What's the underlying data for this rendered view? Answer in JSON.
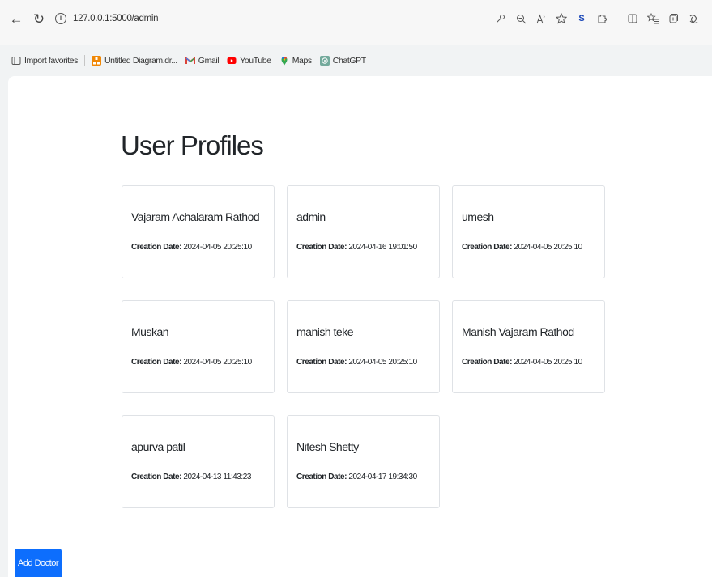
{
  "browser": {
    "url": "127.0.0.1:5000/admin",
    "back_glyph": "←",
    "reload_glyph": "↻",
    "info_glyph": "i",
    "toolbar_icons": [
      "key-icon",
      "zoom-icon",
      "read-aloud-icon",
      "favorite-star-icon",
      "extension-s-icon",
      "extensions-icon",
      "split-screen-icon",
      "favorites-icon",
      "collections-icon",
      "copilot-icon"
    ]
  },
  "bookmarks": [
    {
      "label": "Import favorites",
      "icon": "import-icon",
      "color": "#555555"
    },
    {
      "label": "Untitled Diagram.dr...",
      "icon": "drawio-icon",
      "color": "#f08705"
    },
    {
      "label": "Gmail",
      "icon": "gmail-icon",
      "color": "#d93025"
    },
    {
      "label": "YouTube",
      "icon": "youtube-icon",
      "color": "#ff0000"
    },
    {
      "label": "Maps",
      "icon": "maps-icon",
      "color": "#34a853"
    },
    {
      "label": "ChatGPT",
      "icon": "chatgpt-icon",
      "color": "#74aa9c"
    }
  ],
  "page": {
    "title": "User Profiles",
    "date_label": "Creation Date:",
    "add_button": "Add Doctor",
    "accent": "#0d6efd",
    "profiles": [
      {
        "name": "Vajaram Achalaram Rathod",
        "date": "2024-04-05 20:25:10"
      },
      {
        "name": "admin",
        "date": "2024-04-16 19:01:50"
      },
      {
        "name": "umesh",
        "date": "2024-04-05 20:25:10"
      },
      {
        "name": "Muskan",
        "date": "2024-04-05 20:25:10"
      },
      {
        "name": "manish teke",
        "date": "2024-04-05 20:25:10"
      },
      {
        "name": "Manish Vajaram Rathod",
        "date": "2024-04-05 20:25:10"
      },
      {
        "name": "apurva patil",
        "date": "2024-04-13 11:43:23"
      },
      {
        "name": "Nitesh Shetty",
        "date": "2024-04-17 19:34:30"
      }
    ]
  }
}
